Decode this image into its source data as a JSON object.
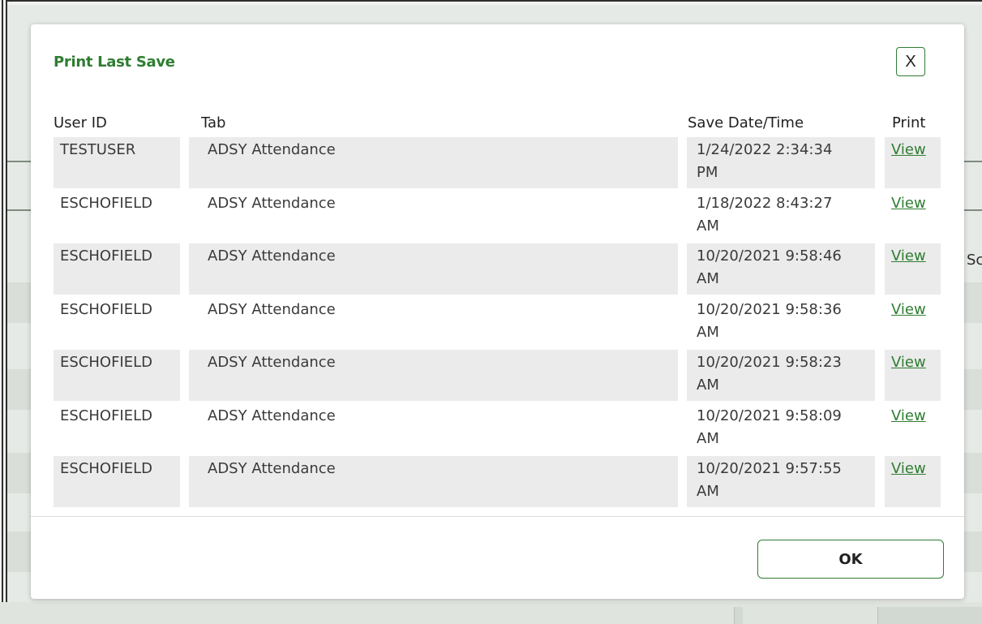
{
  "dialog": {
    "title": "Print Last Save",
    "close_label": "X",
    "ok_label": "OK"
  },
  "background": {
    "partial_text": "Sc"
  },
  "table": {
    "headers": {
      "user_id": "User ID",
      "tab": "Tab",
      "save_datetime": "Save Date/Time",
      "print": "Print"
    },
    "rows": [
      {
        "user_id": "TESTUSER",
        "tab": "ADSY Attendance",
        "date_line1": "1/24/2022 2:34:34",
        "date_line2": "PM",
        "print": "View"
      },
      {
        "user_id": "ESCHOFIELD",
        "tab": "ADSY Attendance",
        "date_line1": "1/18/2022 8:43:27",
        "date_line2": "AM",
        "print": "View"
      },
      {
        "user_id": "ESCHOFIELD",
        "tab": "ADSY Attendance",
        "date_line1": "10/20/2021 9:58:46",
        "date_line2": "AM",
        "print": "View"
      },
      {
        "user_id": "ESCHOFIELD",
        "tab": "ADSY Attendance",
        "date_line1": "10/20/2021 9:58:36",
        "date_line2": "AM",
        "print": "View"
      },
      {
        "user_id": "ESCHOFIELD",
        "tab": "ADSY Attendance",
        "date_line1": "10/20/2021 9:58:23",
        "date_line2": "AM",
        "print": "View"
      },
      {
        "user_id": "ESCHOFIELD",
        "tab": "ADSY Attendance",
        "date_line1": "10/20/2021 9:58:09",
        "date_line2": "AM",
        "print": "View"
      },
      {
        "user_id": "ESCHOFIELD",
        "tab": "ADSY Attendance",
        "date_line1": "10/20/2021 9:57:55",
        "date_line2": "AM",
        "print": "View"
      }
    ]
  },
  "colors": {
    "accent": "#2f7d32",
    "row_shade": "#ebebeb"
  }
}
